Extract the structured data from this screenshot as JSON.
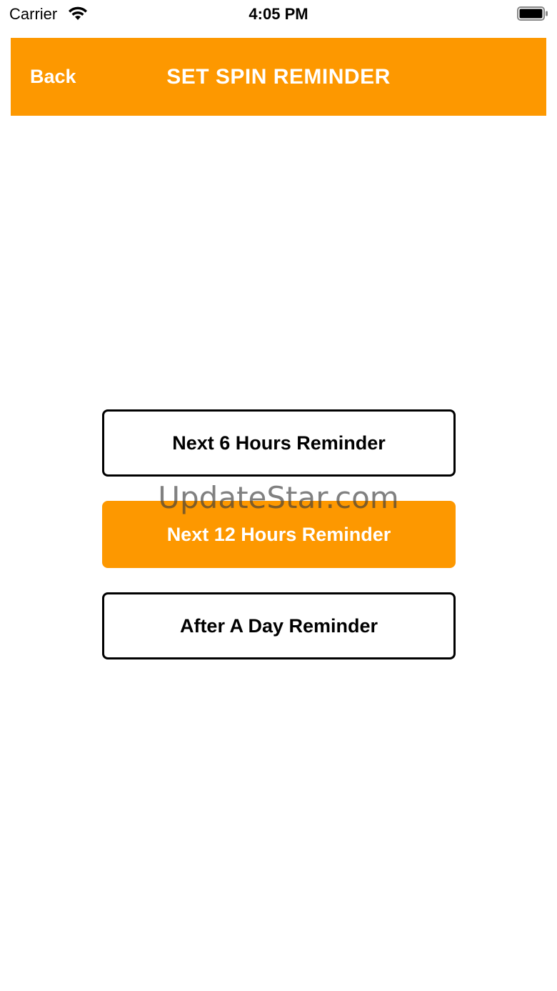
{
  "status_bar": {
    "carrier": "Carrier",
    "time": "4:05 PM",
    "wifi_icon": "wifi-icon",
    "battery_icon": "battery-full-icon"
  },
  "header": {
    "back_label": "Back",
    "title": "SET SPIN REMINDER",
    "color": "#fd9800"
  },
  "options": [
    {
      "label": "Next 6 Hours Reminder",
      "selected": false
    },
    {
      "label": "Next 12 Hours Reminder",
      "selected": true
    },
    {
      "label": "After A Day Reminder",
      "selected": false
    }
  ],
  "watermark": "UpdateStar.com",
  "colors": {
    "accent": "#fd9800",
    "background": "#ffffff",
    "text": "#000000"
  }
}
